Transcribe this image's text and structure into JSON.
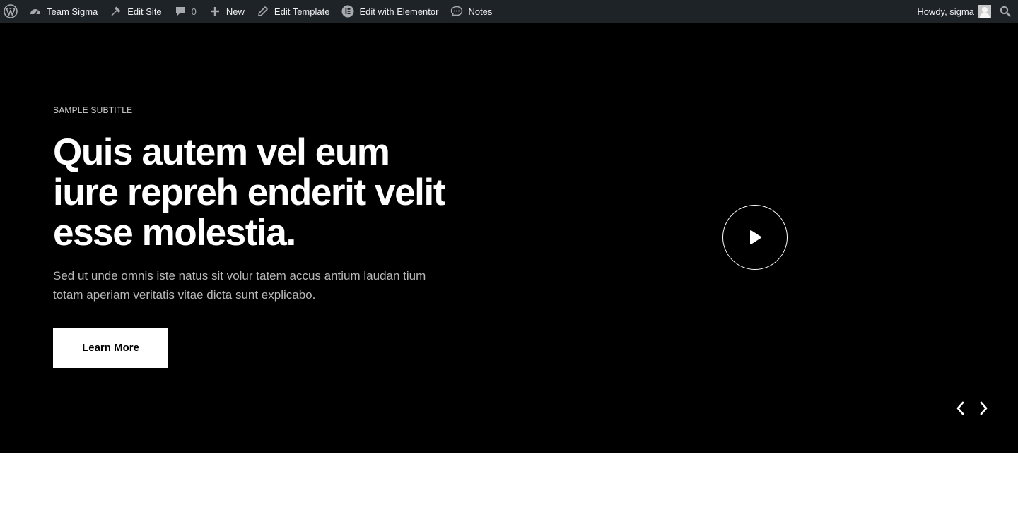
{
  "adminbar": {
    "items": [
      {
        "label": "Team Sigma",
        "icon": "dashboard-icon"
      },
      {
        "label": "Edit Site",
        "icon": "hammer-icon"
      },
      {
        "label": "0",
        "icon": "comment-icon"
      },
      {
        "label": "New",
        "icon": "plus-icon"
      },
      {
        "label": "Edit Template",
        "icon": "pencil-icon"
      },
      {
        "label": "Edit with Elementor",
        "icon": "elementor-icon"
      },
      {
        "label": "Notes",
        "icon": "notes-icon"
      }
    ],
    "greeting": "Howdy, sigma",
    "colors": {
      "bar": "#1d2327",
      "text": "#f0f0f1",
      "icon": "#a7aaad"
    }
  },
  "hero": {
    "subtitle": "SAMPLE SUBTITLE",
    "headline": "Quis autem vel eum iure repreh enderit velit esse molestia.",
    "description": "Sed ut unde omnis iste natus sit volur tatem accus antium laudan tium totam aperiam veritatis vitae dicta sunt explicabo.",
    "cta_label": "Learn More",
    "colors": {
      "background": "#000000",
      "headline": "#ffffff",
      "button_bg": "#ffffff",
      "button_text": "#000000"
    }
  }
}
